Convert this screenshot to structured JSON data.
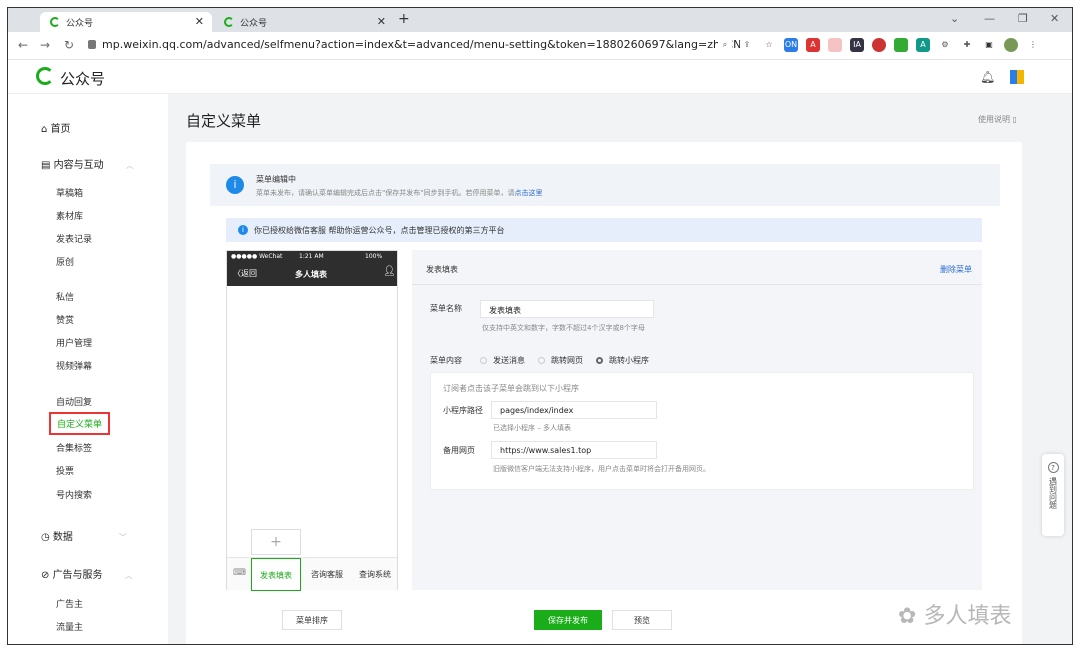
{
  "browser": {
    "tabs": [
      "公众号",
      "公众号"
    ],
    "url": "mp.weixin.qq.com/advanced/selfmenu?action=index&t=advanced/menu-setting&token=1880260697&lang=zh_CN"
  },
  "app": {
    "brand": "公众号"
  },
  "sidebar": {
    "home": "首页",
    "group_content": "内容与互动",
    "content_items": [
      "草稿箱",
      "素材库",
      "发表记录",
      "原创",
      "私信",
      "赞赏",
      "用户管理",
      "视频弹幕",
      "自动回复",
      "自定义菜单",
      "合集标签",
      "投票",
      "号内搜索"
    ],
    "group_data": "数据",
    "group_ads": "广告与服务",
    "ads_items": [
      "广告主",
      "流量主"
    ]
  },
  "page": {
    "title": "自定义菜单",
    "help": "使用说明",
    "notice_title": "菜单编辑中",
    "notice_text": "菜单未发布，请确认菜单编辑完成后点击\"保存并发布\"同步到手机。若停用菜单，请",
    "notice_link": "点击这里",
    "auth_text": "你已授权给微信客服  帮助你运营公众号，点击管理已授权的第三方平台"
  },
  "phone": {
    "carrier": "●●●●● WeChat",
    "time": "1:21 AM",
    "battery": "100%",
    "back": "返回",
    "title": "多人填表",
    "add": "+",
    "menus": [
      "发表填表",
      "咨询客服",
      "查询系统"
    ]
  },
  "editor": {
    "menu_title": "发表填表",
    "delete": "删除菜单",
    "name_label": "菜单名称",
    "name_value": "发表填表",
    "name_hint": "仅支持中英文和数字，字数不超过4个汉字或8个字母",
    "content_label": "菜单内容",
    "options": [
      "发送消息",
      "跳转网页",
      "跳转小程序"
    ],
    "selected": "跳转小程序",
    "sub_intro": "订阅者点击该子菜单会跳到以下小程序",
    "path_label": "小程序路径",
    "path_value": "pages/index/index",
    "path_hint": "已选择小程序 – 多人填表",
    "backup_label": "备用网页",
    "backup_value": "https://www.sales1.top",
    "backup_hint": "旧版微信客户端无法支持小程序，用户点击菜单时将会打开备用网页。"
  },
  "buttons": {
    "sort": "菜单排序",
    "save": "保存并发布",
    "preview": "预览"
  },
  "float_help": "遇到问题",
  "watermark": "多人填表",
  "colors": {
    "accent": "#1aad19",
    "link": "#2a6bd1",
    "highlight_box": "#e33333"
  }
}
